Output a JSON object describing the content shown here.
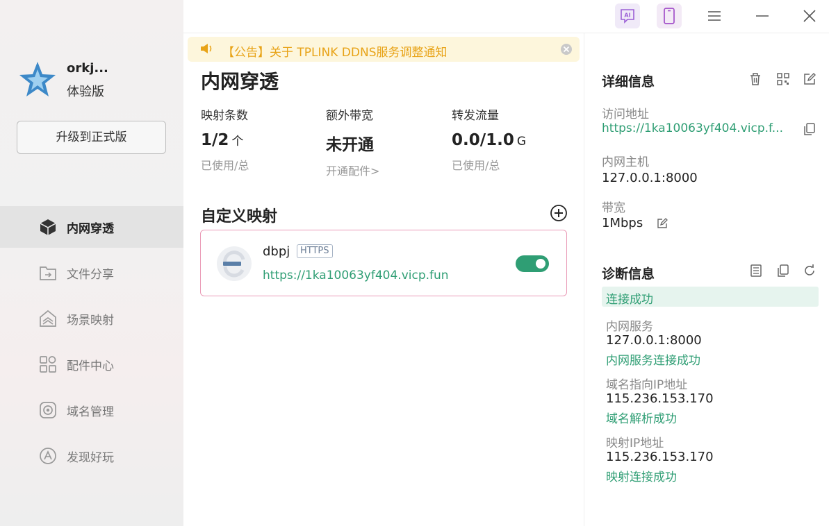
{
  "sidebar": {
    "user_name": "orkj...",
    "plan": "体验版",
    "upgrade_label": "升级到正式版",
    "items": [
      {
        "label": "内网穿透",
        "icon": "cube-icon",
        "active": true
      },
      {
        "label": "文件分享",
        "icon": "folder-share-icon",
        "active": false
      },
      {
        "label": "场景映射",
        "icon": "home-layers-icon",
        "active": false
      },
      {
        "label": "配件中心",
        "icon": "grid-icon",
        "active": false
      },
      {
        "label": "域名管理",
        "icon": "domain-icon",
        "active": false
      },
      {
        "label": "发现好玩",
        "icon": "compass-icon",
        "active": false
      }
    ]
  },
  "topbar": {
    "ai_label": "AI",
    "icons": [
      "ai-chat-icon",
      "mobile-icon",
      "menu-icon",
      "minimize-icon",
      "close-icon"
    ]
  },
  "notice": {
    "text": "【公告】关于 TPLINK DDNS服务调整通知"
  },
  "main": {
    "title": "内网穿透",
    "stats": [
      {
        "label": "映射条数",
        "value": "1/2",
        "unit": "个",
        "sub": "已使用/总"
      },
      {
        "label": "额外带宽",
        "value": "未开通",
        "unit": "",
        "sub": "开通配件>"
      },
      {
        "label": "转发流量",
        "value": "0.0/1.0",
        "unit": "G",
        "sub": "已使用/总"
      }
    ],
    "section_title": "自定义映射",
    "mapping": {
      "name": "dbpj",
      "protocol": "HTTPS",
      "url": "https://1ka10063yf404.vicp.fun",
      "enabled": true
    }
  },
  "details": {
    "title": "详细信息",
    "access_label": "访问地址",
    "access_value": "https://1ka10063yf404.vicp.f...",
    "host_label": "内网主机",
    "host_value": "127.0.0.1:8000",
    "bandwidth_label": "带宽",
    "bandwidth_value": "1Mbps"
  },
  "diagnosis": {
    "title": "诊断信息",
    "status": "连接成功",
    "items": [
      {
        "label": "内网服务",
        "value": "127.0.0.1:8000",
        "result": "内网服务连接成功"
      },
      {
        "label": "域名指向IP地址",
        "value": "115.236.153.170",
        "result": "域名解析成功"
      },
      {
        "label": "映射IP地址",
        "value": "115.236.153.170",
        "result": "映射连接成功"
      }
    ]
  },
  "colors": {
    "accent_green": "#2f9e74",
    "notice_text": "#e8a317",
    "notice_bg": "#fdf6dc",
    "card_border": "#ea9ab6"
  }
}
